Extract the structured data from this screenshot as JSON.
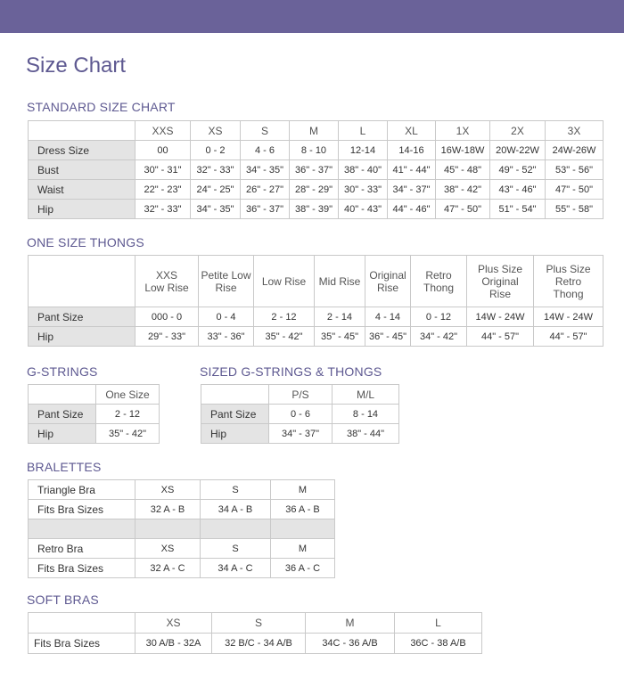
{
  "page_title": "Size Chart",
  "standard": {
    "title": "STANDARD SIZE CHART",
    "headers": [
      "XXS",
      "XS",
      "S",
      "M",
      "L",
      "XL",
      "1X",
      "2X",
      "3X"
    ],
    "rows": [
      {
        "label": "Dress Size",
        "values": [
          "00",
          "0 - 2",
          "4 - 6",
          "8 - 10",
          "12-14",
          "14-16",
          "16W-18W",
          "20W-22W",
          "24W-26W"
        ]
      },
      {
        "label": "Bust",
        "values": [
          "30\" - 31\"",
          "32\" - 33\"",
          "34\" - 35\"",
          "36\" - 37\"",
          "38\" - 40\"",
          "41\" - 44\"",
          "45\" - 48\"",
          "49\" - 52\"",
          "53\" - 56\""
        ]
      },
      {
        "label": "Waist",
        "values": [
          "22\" - 23\"",
          "24\" - 25\"",
          "26\" - 27\"",
          "28\" - 29\"",
          "30\" - 33\"",
          "34\" - 37\"",
          "38\" - 42\"",
          "43\" - 46\"",
          "47\" - 50\""
        ]
      },
      {
        "label": "Hip",
        "values": [
          "32\" - 33\"",
          "34\" - 35\"",
          "36\" - 37\"",
          "38\" - 39\"",
          "40\" - 43\"",
          "44\" - 46\"",
          "47\" - 50\"",
          "51\" - 54\"",
          "55\" - 58\""
        ]
      }
    ]
  },
  "thongs": {
    "title": "ONE SIZE THONGS",
    "headers": [
      "XXS\nLow Rise",
      "Petite Low\nRise",
      "Low Rise",
      "Mid Rise",
      "Original\nRise",
      "Retro\nThong",
      "Plus Size\nOriginal\nRise",
      "Plus Size\nRetro\nThong"
    ],
    "rows": [
      {
        "label": "Pant Size",
        "values": [
          "000 - 0",
          "0 - 4",
          "2 - 12",
          "2 - 14",
          "4 - 14",
          "0 - 12",
          "14W - 24W",
          "14W - 24W"
        ]
      },
      {
        "label": "Hip",
        "values": [
          "29\" - 33\"",
          "33\" - 36\"",
          "35\" - 42\"",
          "35\" - 45\"",
          "36\" - 45\"",
          "34\" - 42\"",
          "44\" - 57\"",
          "44\" - 57\""
        ]
      }
    ]
  },
  "gstrings": {
    "title": "G-STRINGS",
    "headers": [
      "One Size"
    ],
    "rows": [
      {
        "label": "Pant Size",
        "values": [
          "2 - 12"
        ]
      },
      {
        "label": "Hip",
        "values": [
          "35\" - 42\""
        ]
      }
    ]
  },
  "sized_gstrings": {
    "title": "SIZED G-STRINGS & THONGS",
    "headers": [
      "P/S",
      "M/L"
    ],
    "rows": [
      {
        "label": "Pant Size",
        "values": [
          "0 - 6",
          "8 - 14"
        ]
      },
      {
        "label": "Hip",
        "values": [
          "34\" - 37\"",
          "38\" - 44\""
        ]
      }
    ]
  },
  "bralettes": {
    "title": "BRALETTES",
    "rows": [
      {
        "label": "Triangle Bra",
        "values": [
          "XS",
          "S",
          "M"
        ]
      },
      {
        "label": "Fits Bra Sizes",
        "values": [
          "32 A - B",
          "34 A - B",
          "36 A - B"
        ]
      },
      {
        "label": "",
        "values": [
          "",
          "",
          ""
        ]
      },
      {
        "label": "Retro Bra",
        "values": [
          "XS",
          "S",
          "M"
        ]
      },
      {
        "label": "Fits Bra Sizes",
        "values": [
          "32 A - C",
          "34 A - C",
          "36 A - C"
        ]
      }
    ]
  },
  "soft_bras": {
    "title": "SOFT BRAS",
    "headers": [
      "XS",
      "S",
      "M",
      "L"
    ],
    "rows": [
      {
        "label": "Fits Bra Sizes",
        "values": [
          "30 A/B - 32A",
          "32 B/C - 34 A/B",
          "34C - 36 A/B",
          "36C - 38 A/B"
        ]
      }
    ]
  },
  "colors": {
    "accent": "#5e5991",
    "topbar": "#6a6299",
    "label_bg": "#e4e4e4",
    "border": "#c9c9c9"
  }
}
